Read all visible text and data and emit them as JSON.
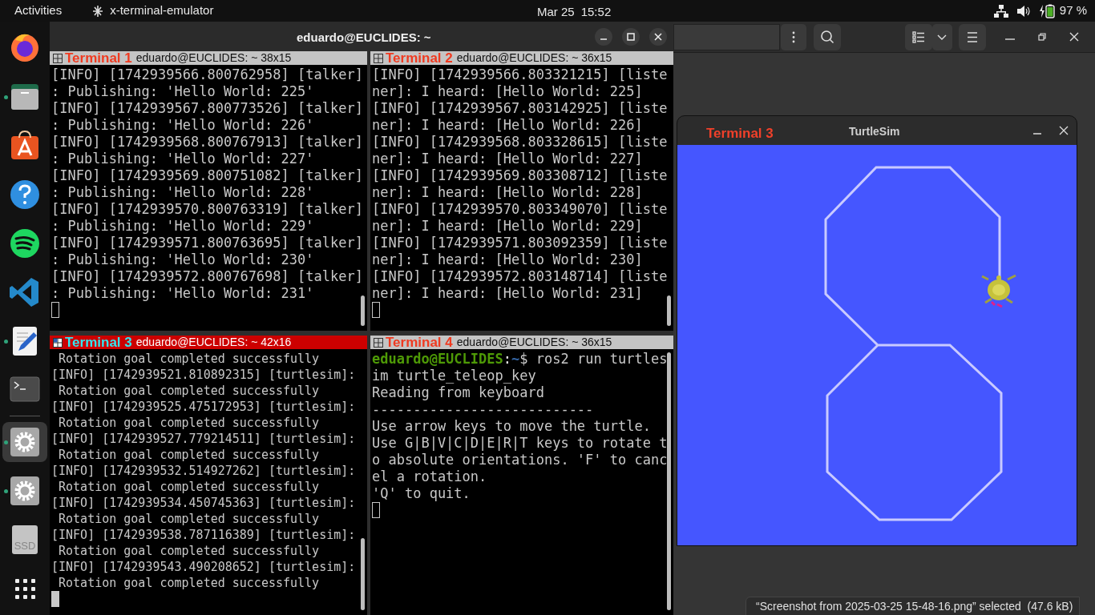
{
  "top_bar": {
    "activities": "Activities",
    "app_name": "x-terminal-emulator",
    "date": "Mar 25",
    "time": "15:52",
    "battery": "97 %"
  },
  "dock": [
    {
      "kind": "firefox",
      "running": false,
      "active": false
    },
    {
      "kind": "files",
      "running": true,
      "active": false
    },
    {
      "kind": "store",
      "running": false,
      "active": false
    },
    {
      "kind": "help",
      "running": false,
      "active": false
    },
    {
      "kind": "music",
      "running": false,
      "active": false
    },
    {
      "kind": "code",
      "running": false,
      "active": false
    },
    {
      "kind": "editor",
      "running": true,
      "active": false
    },
    {
      "kind": "terminal",
      "running": false,
      "active": false
    },
    {
      "kind": "settings",
      "running": true,
      "active": true
    },
    {
      "kind": "settings",
      "running": true,
      "active": false
    },
    {
      "kind": "drive",
      "label": "SSD",
      "running": false,
      "active": false
    },
    {
      "kind": "apps",
      "running": false,
      "active": false
    }
  ],
  "terminal_window": {
    "title": "eduardo@EUCLIDES: ~",
    "panes": [
      {
        "name": "Terminal 1",
        "info": "eduardo@EUCLIDES: ~ 38x15",
        "focused": false,
        "cursor_filled": false,
        "lines": [
          {
            "text": "[INFO] [1742939566.800762958] [talker]"
          },
          {
            "text": ": Publishing: 'Hello World: 225'"
          },
          {
            "text": "[INFO] [1742939567.800773526] [talker]"
          },
          {
            "text": ": Publishing: 'Hello World: 226'"
          },
          {
            "text": "[INFO] [1742939568.800767913] [talker]"
          },
          {
            "text": ": Publishing: 'Hello World: 227'"
          },
          {
            "text": "[INFO] [1742939569.800751082] [talker]"
          },
          {
            "text": ": Publishing: 'Hello World: 228'"
          },
          {
            "text": "[INFO] [1742939570.800763319] [talker]"
          },
          {
            "text": ": Publishing: 'Hello World: 229'"
          },
          {
            "text": "[INFO] [1742939571.800763695] [talker]"
          },
          {
            "text": ": Publishing: 'Hello World: 230'"
          },
          {
            "text": "[INFO] [1742939572.800767698] [talker]"
          },
          {
            "text": ": Publishing: 'Hello World: 231'"
          }
        ]
      },
      {
        "name": "Terminal 2",
        "info": "eduardo@EUCLIDES: ~ 36x15",
        "focused": false,
        "cursor_filled": false,
        "lines": [
          {
            "text": "[INFO] [1742939566.803321215] [liste"
          },
          {
            "text": "ner]: I heard: [Hello World: 225]"
          },
          {
            "text": "[INFO] [1742939567.803142925] [liste"
          },
          {
            "text": "ner]: I heard: [Hello World: 226]"
          },
          {
            "text": "[INFO] [1742939568.803328615] [liste"
          },
          {
            "text": "ner]: I heard: [Hello World: 227]"
          },
          {
            "text": "[INFO] [1742939569.803308712] [liste"
          },
          {
            "text": "ner]: I heard: [Hello World: 228]"
          },
          {
            "text": "[INFO] [1742939570.803349070] [liste"
          },
          {
            "text": "ner]: I heard: [Hello World: 229]"
          },
          {
            "text": "[INFO] [1742939571.803092359] [liste"
          },
          {
            "text": "ner]: I heard: [Hello World: 230]"
          },
          {
            "text": "[INFO] [1742939572.803148714] [liste"
          },
          {
            "text": "ner]: I heard: [Hello World: 231]"
          }
        ]
      },
      {
        "name": "Terminal 3",
        "info": "eduardo@EUCLIDES: ~ 42x16",
        "focused": true,
        "cursor_filled": true,
        "lines": [
          {
            "text": " Rotation goal completed successfully"
          },
          {
            "text": "[INFO] [1742939521.810892315] [turtlesim]:"
          },
          {
            "text": " Rotation goal completed successfully"
          },
          {
            "text": "[INFO] [1742939525.475172953] [turtlesim]:"
          },
          {
            "text": " Rotation goal completed successfully"
          },
          {
            "text": "[INFO] [1742939527.779214511] [turtlesim]:"
          },
          {
            "text": " Rotation goal completed successfully"
          },
          {
            "text": "[INFO] [1742939532.514927262] [turtlesim]:"
          },
          {
            "text": " Rotation goal completed successfully"
          },
          {
            "text": "[INFO] [1742939534.450745363] [turtlesim]:"
          },
          {
            "text": " Rotation goal completed successfully"
          },
          {
            "text": "[INFO] [1742939538.787116389] [turtlesim]:"
          },
          {
            "text": " Rotation goal completed successfully"
          },
          {
            "text": "[INFO] [1742939543.490208652] [turtlesim]:"
          },
          {
            "text": " Rotation goal completed successfully"
          }
        ]
      },
      {
        "name": "Terminal 4",
        "info": "eduardo@EUCLIDES: ~ 36x15",
        "focused": false,
        "cursor_filled": false,
        "lines": [
          {
            "kind": "prompt",
            "user_host": "eduardo@EUCLIDES",
            "sep": ":",
            "path": "~",
            "command": "$ ros2 run turtles"
          },
          {
            "text": "im turtle_teleop_key"
          },
          {
            "text": "Reading from keyboard"
          },
          {
            "text": "---------------------------"
          },
          {
            "text": "Use arrow keys to move the turtle."
          },
          {
            "text": "Use G|B|V|C|D|E|R|T keys to rotate t"
          },
          {
            "text": "o absolute orientations. 'F' to canc"
          },
          {
            "text": "el a rotation."
          },
          {
            "text": "'Q' to quit."
          }
        ]
      }
    ]
  },
  "turtlesim_window": {
    "label": "Terminal 3",
    "title": "TurtleSim"
  },
  "status_overlay": "“Screenshot from 2025-03-25 15-48-16.png” selected  (47.6 kB)"
}
